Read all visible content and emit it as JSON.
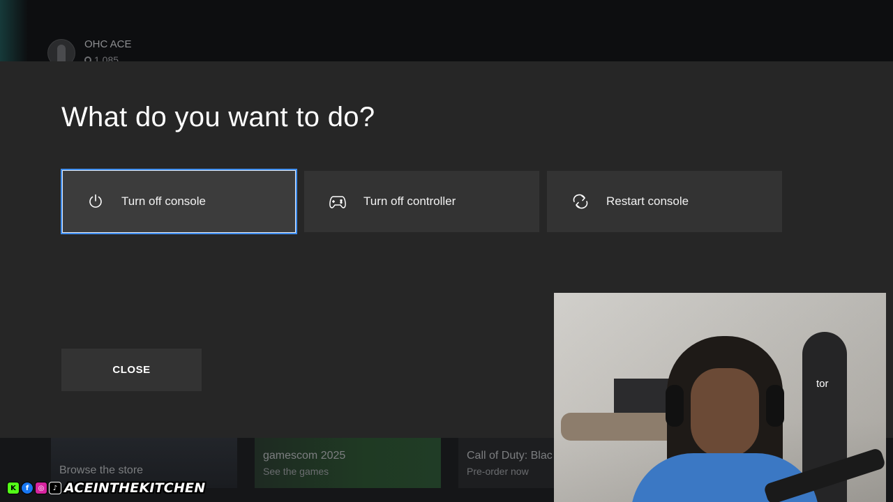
{
  "background": {
    "profile": {
      "gamertag": "OHC ACE",
      "gamerscore": "1,085"
    },
    "tiles": [
      {
        "title": "Browse the store",
        "subtitle": ""
      },
      {
        "title": "gamescom 2025",
        "subtitle": "See the games"
      },
      {
        "title": "Call of Duty: Blac",
        "subtitle": "Pre-order now"
      }
    ]
  },
  "dialog": {
    "title": "What do you want to do?",
    "options": [
      {
        "label": "Turn off console",
        "icon": "power-icon",
        "focused": true
      },
      {
        "label": "Turn off controller",
        "icon": "controller-icon",
        "focused": false
      },
      {
        "label": "Restart console",
        "icon": "restart-icon",
        "focused": false
      }
    ],
    "close_label": "CLOSE"
  },
  "webcam": {
    "background_text": "tor"
  },
  "watermark": {
    "channel": "ACEINTHEKITCHEN",
    "socials": [
      "K",
      "f",
      "◎",
      "♪"
    ]
  },
  "colors": {
    "dialog_bg": "#262626",
    "button_bg": "#333333",
    "focus_border": "#3f8ef0"
  }
}
